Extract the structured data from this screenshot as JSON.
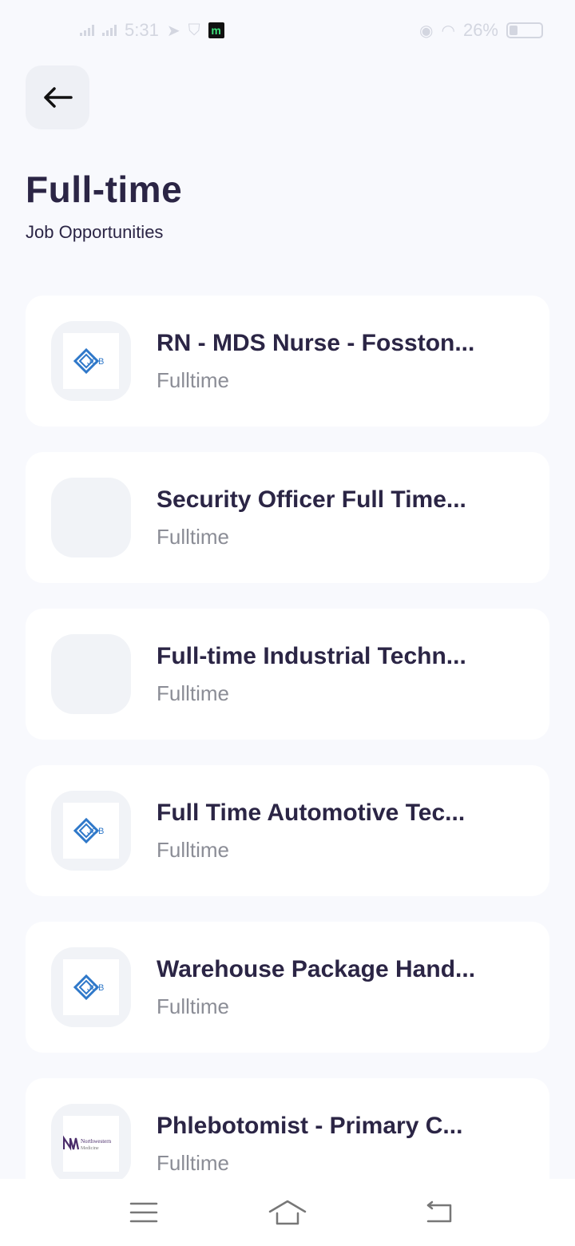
{
  "status_bar": {
    "time": "5:31",
    "battery_percent": "26%",
    "app_badge": "m"
  },
  "header": {
    "title": "Full-time",
    "subtitle": "Job Opportunities"
  },
  "jobs": [
    {
      "title": "RN - MDS Nurse - Fosston...",
      "type": "Fulltime",
      "logo": "job-logo"
    },
    {
      "title": "Security Officer Full Time...",
      "type": "Fulltime",
      "logo": "none"
    },
    {
      "title": "Full-time Industrial Techn...",
      "type": "Fulltime",
      "logo": "none"
    },
    {
      "title": "Full Time Automotive Tec...",
      "type": "Fulltime",
      "logo": "job-logo"
    },
    {
      "title": "Warehouse Package Hand...",
      "type": "Fulltime",
      "logo": "job-logo"
    },
    {
      "title": "Phlebotomist - Primary C...",
      "type": "Fulltime",
      "logo": "northwestern-logo"
    }
  ],
  "logos": {
    "job_text": "JOB",
    "northwestern_text": "Northwestern",
    "northwestern_sub": "Medicine"
  },
  "colors": {
    "background": "#f8f9fd",
    "title": "#2b2545",
    "subtle": "#8b8d96",
    "logo_blue": "#2f78c9"
  }
}
